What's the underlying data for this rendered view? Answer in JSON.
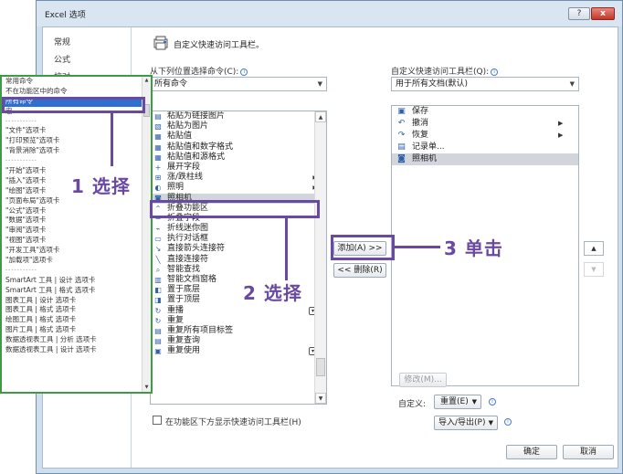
{
  "window": {
    "title": "Excel 选项",
    "help_label": "?",
    "close_label": "x"
  },
  "sidebar": {
    "items": [
      "常规",
      "公式",
      "校对"
    ]
  },
  "header": {
    "title": "自定义快速访问工具栏。"
  },
  "choose": {
    "label": "从下列位置选择命令(C):",
    "value": "所有命令"
  },
  "customize": {
    "label": "自定义快速访问工具栏(Q):",
    "value": "用于所有文档(默认)"
  },
  "commands": [
    {
      "label": "粘贴为链接图片",
      "icon": "paste-link-icon"
    },
    {
      "label": "粘贴为图片",
      "icon": "paste-picture-icon"
    },
    {
      "label": "粘贴值",
      "icon": "paste-values-icon"
    },
    {
      "label": "粘贴值和数字格式",
      "icon": "paste-values-number-icon"
    },
    {
      "label": "粘贴值和源格式",
      "icon": "paste-values-source-icon"
    },
    {
      "label": "展开字段",
      "icon": "expand-field-icon"
    },
    {
      "label": "涨/跌柱线",
      "icon": "updown-bars-icon",
      "submenu": true
    },
    {
      "label": "照明",
      "icon": "lighting-icon",
      "submenu": true
    },
    {
      "label": "照相机",
      "icon": "camera-icon",
      "selected": true
    },
    {
      "label": "折叠功能区",
      "icon": "collapse-ribbon-icon"
    },
    {
      "label": "折叠字段",
      "icon": "collapse-field-icon"
    },
    {
      "label": "折线迷你图",
      "icon": "sparkline-icon"
    },
    {
      "label": "执行对话框",
      "icon": "dialog-icon"
    },
    {
      "label": "直接箭头连接符",
      "icon": "arrow-connector-icon"
    },
    {
      "label": "直接连接符",
      "icon": "connector-icon"
    },
    {
      "label": "智能查找",
      "icon": "smart-lookup-icon"
    },
    {
      "label": "智能文档窗格",
      "icon": "doc-pane-icon"
    },
    {
      "label": "置于底层",
      "icon": "send-back-icon"
    },
    {
      "label": "置于顶层",
      "icon": "bring-front-icon"
    },
    {
      "label": "重播",
      "icon": "replay-icon",
      "dropdown": true
    },
    {
      "label": "重复",
      "icon": "repeat-icon"
    },
    {
      "label": "重复所有项目标签",
      "icon": "repeat-labels-icon"
    },
    {
      "label": "重复查询",
      "icon": "repeat-query-icon"
    },
    {
      "label": "重复使用",
      "icon": "reuse-icon",
      "dropdown": true
    }
  ],
  "qat_items": [
    {
      "label": "保存",
      "icon": "save-icon"
    },
    {
      "label": "撤消",
      "icon": "undo-icon",
      "submenu": true
    },
    {
      "label": "恢复",
      "icon": "redo-icon",
      "submenu": true
    },
    {
      "label": "记录单...",
      "icon": "form-icon"
    },
    {
      "label": "照相机",
      "icon": "camera-icon",
      "selected": true
    }
  ],
  "buttons": {
    "add": "添加(A) >>",
    "remove": "<< 删除(R)",
    "modify": "修改(M)...",
    "reset": "重置(E)",
    "import_export": "导入/导出(P)",
    "ok": "确定",
    "cancel": "取消"
  },
  "customize_label": "自定义:",
  "checkbox_label": "在功能区下方显示快速访问工具栏(H)",
  "callout_list": [
    {
      "label": "常用命令"
    },
    {
      "label": "不在功能区中的命令"
    },
    {
      "label": "所有命令",
      "selected": true
    },
    {
      "label": "宏"
    },
    {
      "label": "-----------",
      "sep": true
    },
    {
      "label": "\"文件\"选项卡"
    },
    {
      "label": "\"打印预览\"选项卡"
    },
    {
      "label": "\"背景消除\"选项卡"
    },
    {
      "label": "-----------",
      "sep": true
    },
    {
      "label": "\"开始\"选项卡"
    },
    {
      "label": "\"插入\"选项卡"
    },
    {
      "label": "\"绘图\"选项卡"
    },
    {
      "label": "\"页面布局\"选项卡"
    },
    {
      "label": "\"公式\"选项卡"
    },
    {
      "label": "\"数据\"选项卡"
    },
    {
      "label": "\"审阅\"选项卡"
    },
    {
      "label": "\"视图\"选项卡"
    },
    {
      "label": "\"开发工具\"选项卡"
    },
    {
      "label": "\"加载项\"选项卡"
    },
    {
      "label": "-----------",
      "sep": true
    },
    {
      "label": "SmartArt 工具 | 设计 选项卡"
    },
    {
      "label": "SmartArt 工具 | 格式 选项卡"
    },
    {
      "label": "图表工具 | 设计 选项卡"
    },
    {
      "label": "图表工具 | 格式 选项卡"
    },
    {
      "label": "绘图工具 | 格式 选项卡"
    },
    {
      "label": "图片工具 | 格式 选项卡"
    },
    {
      "label": "数据透视表工具 | 分析 选项卡"
    },
    {
      "label": "数据透视表工具 | 设计 选项卡"
    }
  ],
  "annotations": {
    "step1": "1 选择",
    "step2": "2 选择",
    "step3": "3 单击"
  },
  "colors": {
    "annotation": "#6a4aa0",
    "callout_border": "#3f9a45",
    "selection": "#2f6fcf"
  }
}
